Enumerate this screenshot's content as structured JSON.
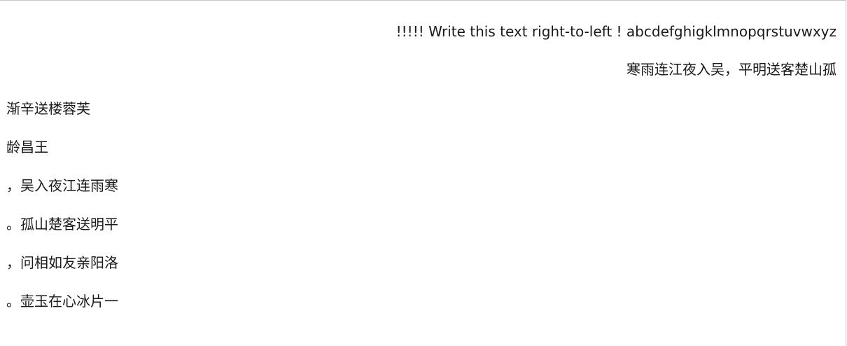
{
  "lines": [
    "!!!!! Write this text right-to-left ! abcdefghigklmnopqrstuvwxyz",
    "寒雨连江夜入吴，平明送客楚山孤",
    "渐辛送楼蓉芙",
    "龄昌王",
    "，吴入夜江连雨寒",
    "。孤山楚客送明平",
    "，问相如友亲阳洛",
    "。壶玉在心冰片一"
  ]
}
